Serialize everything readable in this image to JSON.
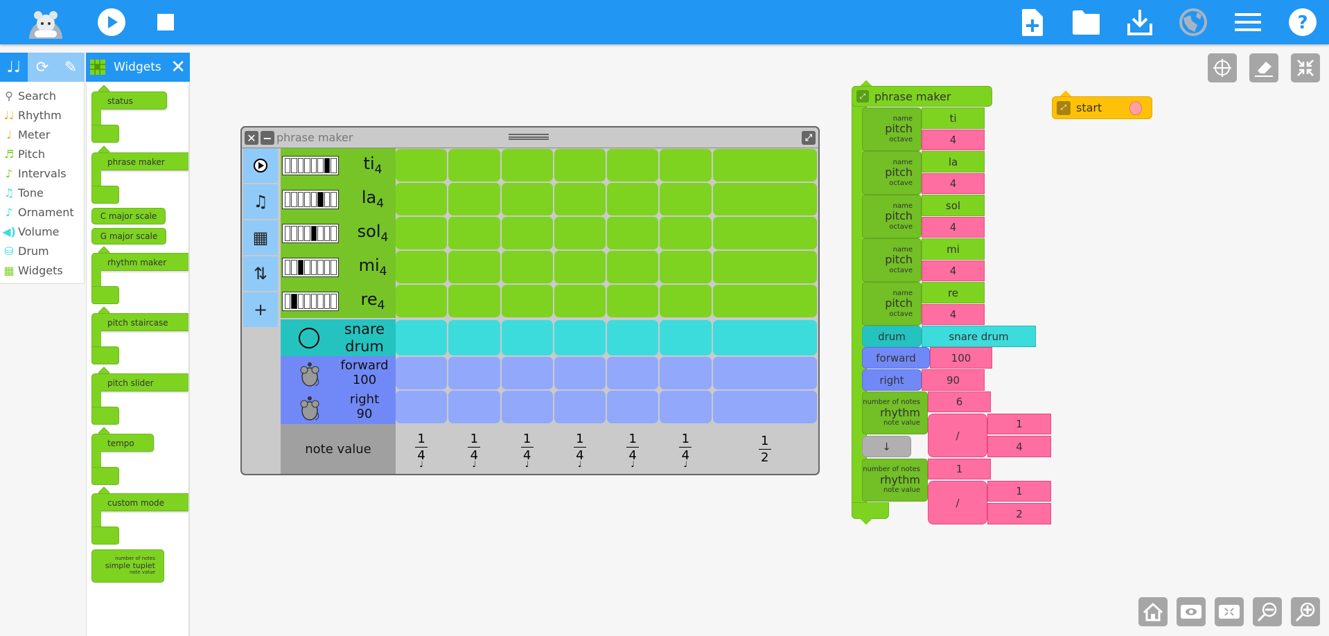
{
  "topbar": {
    "left_icons": [
      "mouse-logo-icon",
      "play-icon",
      "stop-icon"
    ],
    "right_icons": [
      "new-file-icon",
      "folder-icon",
      "download-icon",
      "globe-icon",
      "menu-icon",
      "help-icon"
    ],
    "color": "#2196f3"
  },
  "palette": {
    "tabs": [
      "music-notes-icon",
      "refresh-icon",
      "pencil-icon"
    ],
    "items": [
      {
        "label": "Search",
        "icon": "search-icon",
        "glyph": "⚲",
        "color": "#777777"
      },
      {
        "label": "Rhythm",
        "icon": "rhythm-icon",
        "glyph": "♩♩",
        "color": "#f5a623"
      },
      {
        "label": "Meter",
        "icon": "meter-icon",
        "glyph": "♩",
        "color": "#f5a623"
      },
      {
        "label": "Pitch",
        "icon": "pitch-icon",
        "glyph": "♬",
        "color": "#7ed321"
      },
      {
        "label": "Intervals",
        "icon": "intervals-icon",
        "glyph": "♪",
        "color": "#7ed321"
      },
      {
        "label": "Tone",
        "icon": "tone-icon",
        "glyph": "♫",
        "color": "#3ddcdc"
      },
      {
        "label": "Ornament",
        "icon": "ornament-icon",
        "glyph": "♪",
        "color": "#3ddcdc"
      },
      {
        "label": "Volume",
        "icon": "volume-icon",
        "glyph": "◀)",
        "color": "#3ddcdc"
      },
      {
        "label": "Drum",
        "icon": "drum-icon",
        "glyph": "⛁",
        "color": "#3ddcdc"
      },
      {
        "label": "Widgets",
        "icon": "widgets-icon",
        "glyph": "▦",
        "color": "#7ed321"
      }
    ],
    "widgets_header": "Widgets",
    "widget_blocks": [
      {
        "label": "status",
        "type": "clamp"
      },
      {
        "label": "phrase maker",
        "type": "clamp"
      },
      {
        "label": "C major scale",
        "type": "flat"
      },
      {
        "label": "G major scale",
        "type": "flat"
      },
      {
        "label": "rhythm maker",
        "type": "clamp"
      },
      {
        "label": "pitch staircase",
        "type": "clamp"
      },
      {
        "label": "pitch slider",
        "type": "clamp"
      },
      {
        "label": "tempo",
        "type": "clamp"
      },
      {
        "label": "custom mode",
        "type": "clamp"
      },
      {
        "label": "simple tuplet",
        "type": "tuplet",
        "arg1": "number of notes",
        "arg2": "note value"
      }
    ]
  },
  "phrase_maker": {
    "title": "phrase maker",
    "side_buttons": [
      "play-icon",
      "save-icon",
      "erase-grid-icon",
      "sort-icon",
      "add-icon"
    ],
    "add_label": "+",
    "pitch_rows": [
      {
        "name": "ti",
        "octave": "4",
        "highlighted_key": 7
      },
      {
        "name": "la",
        "octave": "4",
        "highlighted_key": 6
      },
      {
        "name": "sol",
        "octave": "4",
        "highlighted_key": 5
      },
      {
        "name": "mi",
        "octave": "4",
        "highlighted_key": 3
      },
      {
        "name": "re",
        "octave": "4",
        "highlighted_key": 2
      }
    ],
    "drum_row": {
      "line1": "snare",
      "line2": "drum"
    },
    "turtle_rows": [
      {
        "line1": "forward",
        "line2": "100"
      },
      {
        "line1": "right",
        "line2": "90"
      }
    ],
    "note_value_label": "note value",
    "note_values": [
      {
        "num": "1",
        "den": "4",
        "value": 0.25
      },
      {
        "num": "1",
        "den": "4",
        "value": 0.25
      },
      {
        "num": "1",
        "den": "4",
        "value": 0.25
      },
      {
        "num": "1",
        "den": "4",
        "value": 0.25
      },
      {
        "num": "1",
        "den": "4",
        "value": 0.25
      },
      {
        "num": "1",
        "den": "4",
        "value": 0.25
      },
      {
        "num": "1",
        "den": "2",
        "value": 0.5
      }
    ],
    "colors": {
      "pitch_label": "#77c428",
      "pitch_cell": "#7ed321",
      "drum_label": "#25c3c0",
      "drum_cell": "#3ddcdc",
      "turtle_label": "#7189f7",
      "turtle_cell": "#91a8fb",
      "note_label": "#a0a0a0"
    }
  },
  "program": {
    "phrase_maker_label": "phrase maker",
    "pitches": [
      {
        "label": "pitch",
        "name_arg": "name",
        "octave_arg": "octave",
        "name": "ti",
        "octave": "4"
      },
      {
        "label": "pitch",
        "name_arg": "name",
        "octave_arg": "octave",
        "name": "la",
        "octave": "4"
      },
      {
        "label": "pitch",
        "name_arg": "name",
        "octave_arg": "octave",
        "name": "sol",
        "octave": "4"
      },
      {
        "label": "pitch",
        "name_arg": "name",
        "octave_arg": "octave",
        "name": "mi",
        "octave": "4"
      },
      {
        "label": "pitch",
        "name_arg": "name",
        "octave_arg": "octave",
        "name": "re",
        "octave": "4"
      }
    ],
    "drum": {
      "label": "drum",
      "value": "snare drum"
    },
    "forward": {
      "label": "forward",
      "value": "100"
    },
    "right": {
      "label": "right",
      "value": "90"
    },
    "rhythm1": {
      "label": "rhythm",
      "arg1": "number of notes",
      "arg2": "note value",
      "count": "6",
      "div": "/",
      "num": "1",
      "den": "4"
    },
    "arrow": "↓",
    "rhythm2": {
      "label": "rhythm",
      "arg1": "number of notes",
      "arg2": "note value",
      "count": "1",
      "div": "/",
      "num": "1",
      "den": "2"
    },
    "start_label": "start"
  },
  "canvas_buttons_top": [
    "grid-icon",
    "clear-icon",
    "collapse-icon"
  ],
  "canvas_buttons_bottom": [
    "home-icon",
    "show-blocks-icon",
    "expand-blocks-icon",
    "zoom-out-icon",
    "zoom-in-icon"
  ]
}
